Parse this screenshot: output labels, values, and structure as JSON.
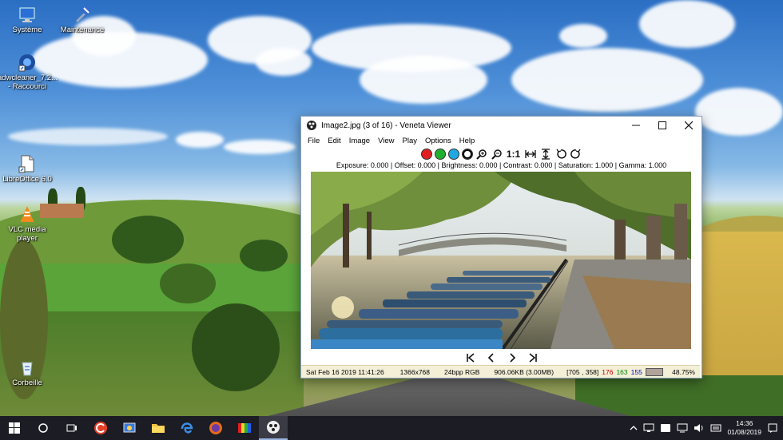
{
  "desktop_icons": [
    {
      "label": "Système",
      "icon": "system-icon"
    },
    {
      "label": "Maintenance",
      "icon": "maintenance-icon"
    },
    {
      "label": "adwcleaner_7.2... - Raccourci",
      "icon": "adwcleaner-icon"
    },
    {
      "label": "LibreOffice 6.0",
      "icon": "libreoffice-icon"
    },
    {
      "label": "VLC media player",
      "icon": "vlc-icon"
    },
    {
      "label": "Corbeille",
      "icon": "recycle-bin-icon"
    }
  ],
  "window": {
    "title": "Image2.jpg (3 of 16) - Veneta Viewer",
    "menu": [
      "File",
      "Edit",
      "Image",
      "View",
      "Play",
      "Options",
      "Help"
    ],
    "toolbar_zoom_label": "1:1",
    "color_dots": [
      "#e02020",
      "#20b030",
      "#20a8e0",
      "#ffffff"
    ],
    "params": "Exposure: 0.000 | Offset: 0.000 | Brightness: 0.000 | Contrast: 0.000 | Saturation: 1.000 | Gamma: 1.000",
    "status": {
      "date": "Sat Feb 16 2019 11:41:26",
      "size": "1366x768",
      "depth": "24bpp RGB",
      "filesize": "906.06KB (3.00MB)",
      "coords": "[705 , 358]",
      "r": "176",
      "g": "163",
      "b": "155",
      "zoom": "48.75%"
    }
  },
  "taskbar": {
    "tray_time": "14:36",
    "tray_date": "01/08/2019"
  }
}
